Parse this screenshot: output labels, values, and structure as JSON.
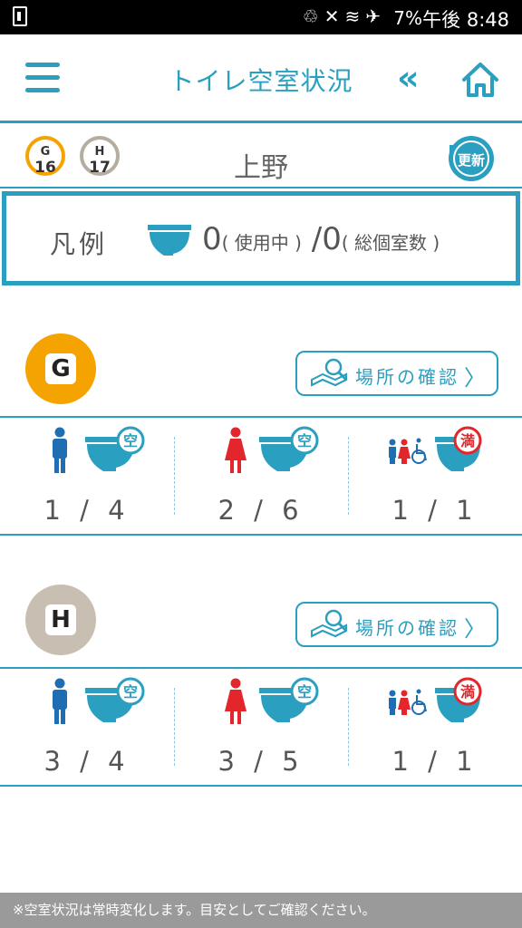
{
  "status_bar": {
    "battery": "7%",
    "time": "午後 8:48"
  },
  "header": {
    "title": "トイレ空室状況"
  },
  "station": {
    "name": "上野",
    "codes": [
      {
        "letter": "G",
        "number": "16",
        "color": "#f5a300"
      },
      {
        "letter": "H",
        "number": "17",
        "color": "#b5ada0"
      }
    ],
    "refresh_label": "更新"
  },
  "legend": {
    "label": "凡例",
    "in_use": "0",
    "in_use_label": "( 使用中 )",
    "slash": "/",
    "total": "0",
    "total_label": "( 総個室数 )"
  },
  "lines": [
    {
      "letter": "G",
      "color": "#f5a300",
      "location_button": "場所の確認",
      "rest_rooms": [
        {
          "type": "men",
          "status": "空",
          "count": "1 / 4"
        },
        {
          "type": "women",
          "status": "空",
          "count": "2 / 6"
        },
        {
          "type": "multipurpose",
          "status": "満",
          "count": "1 / 1"
        }
      ]
    },
    {
      "letter": "H",
      "color": "#c8bfb2",
      "location_button": "場所の確認",
      "rest_rooms": [
        {
          "type": "men",
          "status": "空",
          "count": "3 / 4"
        },
        {
          "type": "women",
          "status": "空",
          "count": "3 / 5"
        },
        {
          "type": "multipurpose",
          "status": "満",
          "count": "1 / 1"
        }
      ]
    }
  ],
  "footer": {
    "note": "※空室状況は常時変化します。目安としてご確認ください。"
  },
  "colors": {
    "accent": "#2a9fc0",
    "vacant": "#2a9fc0",
    "full": "#e2262b",
    "men": "#1f6db3",
    "women": "#e2262b"
  }
}
